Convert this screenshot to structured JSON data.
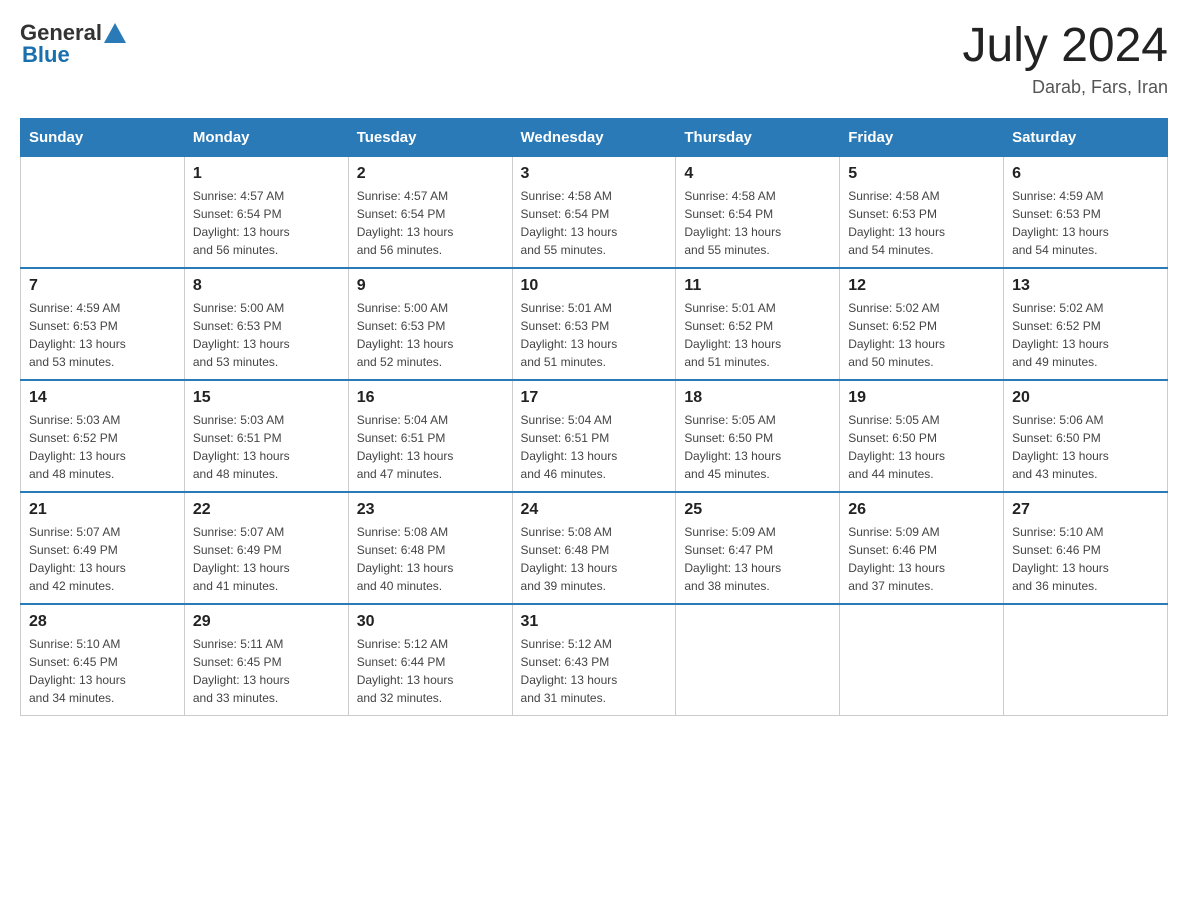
{
  "header": {
    "logo_general": "General",
    "logo_blue": "Blue",
    "month_year": "July 2024",
    "location": "Darab, Fars, Iran"
  },
  "days_of_week": [
    "Sunday",
    "Monday",
    "Tuesday",
    "Wednesday",
    "Thursday",
    "Friday",
    "Saturday"
  ],
  "weeks": [
    [
      {
        "day": "",
        "info": ""
      },
      {
        "day": "1",
        "info": "Sunrise: 4:57 AM\nSunset: 6:54 PM\nDaylight: 13 hours\nand 56 minutes."
      },
      {
        "day": "2",
        "info": "Sunrise: 4:57 AM\nSunset: 6:54 PM\nDaylight: 13 hours\nand 56 minutes."
      },
      {
        "day": "3",
        "info": "Sunrise: 4:58 AM\nSunset: 6:54 PM\nDaylight: 13 hours\nand 55 minutes."
      },
      {
        "day": "4",
        "info": "Sunrise: 4:58 AM\nSunset: 6:54 PM\nDaylight: 13 hours\nand 55 minutes."
      },
      {
        "day": "5",
        "info": "Sunrise: 4:58 AM\nSunset: 6:53 PM\nDaylight: 13 hours\nand 54 minutes."
      },
      {
        "day": "6",
        "info": "Sunrise: 4:59 AM\nSunset: 6:53 PM\nDaylight: 13 hours\nand 54 minutes."
      }
    ],
    [
      {
        "day": "7",
        "info": "Sunrise: 4:59 AM\nSunset: 6:53 PM\nDaylight: 13 hours\nand 53 minutes."
      },
      {
        "day": "8",
        "info": "Sunrise: 5:00 AM\nSunset: 6:53 PM\nDaylight: 13 hours\nand 53 minutes."
      },
      {
        "day": "9",
        "info": "Sunrise: 5:00 AM\nSunset: 6:53 PM\nDaylight: 13 hours\nand 52 minutes."
      },
      {
        "day": "10",
        "info": "Sunrise: 5:01 AM\nSunset: 6:53 PM\nDaylight: 13 hours\nand 51 minutes."
      },
      {
        "day": "11",
        "info": "Sunrise: 5:01 AM\nSunset: 6:52 PM\nDaylight: 13 hours\nand 51 minutes."
      },
      {
        "day": "12",
        "info": "Sunrise: 5:02 AM\nSunset: 6:52 PM\nDaylight: 13 hours\nand 50 minutes."
      },
      {
        "day": "13",
        "info": "Sunrise: 5:02 AM\nSunset: 6:52 PM\nDaylight: 13 hours\nand 49 minutes."
      }
    ],
    [
      {
        "day": "14",
        "info": "Sunrise: 5:03 AM\nSunset: 6:52 PM\nDaylight: 13 hours\nand 48 minutes."
      },
      {
        "day": "15",
        "info": "Sunrise: 5:03 AM\nSunset: 6:51 PM\nDaylight: 13 hours\nand 48 minutes."
      },
      {
        "day": "16",
        "info": "Sunrise: 5:04 AM\nSunset: 6:51 PM\nDaylight: 13 hours\nand 47 minutes."
      },
      {
        "day": "17",
        "info": "Sunrise: 5:04 AM\nSunset: 6:51 PM\nDaylight: 13 hours\nand 46 minutes."
      },
      {
        "day": "18",
        "info": "Sunrise: 5:05 AM\nSunset: 6:50 PM\nDaylight: 13 hours\nand 45 minutes."
      },
      {
        "day": "19",
        "info": "Sunrise: 5:05 AM\nSunset: 6:50 PM\nDaylight: 13 hours\nand 44 minutes."
      },
      {
        "day": "20",
        "info": "Sunrise: 5:06 AM\nSunset: 6:50 PM\nDaylight: 13 hours\nand 43 minutes."
      }
    ],
    [
      {
        "day": "21",
        "info": "Sunrise: 5:07 AM\nSunset: 6:49 PM\nDaylight: 13 hours\nand 42 minutes."
      },
      {
        "day": "22",
        "info": "Sunrise: 5:07 AM\nSunset: 6:49 PM\nDaylight: 13 hours\nand 41 minutes."
      },
      {
        "day": "23",
        "info": "Sunrise: 5:08 AM\nSunset: 6:48 PM\nDaylight: 13 hours\nand 40 minutes."
      },
      {
        "day": "24",
        "info": "Sunrise: 5:08 AM\nSunset: 6:48 PM\nDaylight: 13 hours\nand 39 minutes."
      },
      {
        "day": "25",
        "info": "Sunrise: 5:09 AM\nSunset: 6:47 PM\nDaylight: 13 hours\nand 38 minutes."
      },
      {
        "day": "26",
        "info": "Sunrise: 5:09 AM\nSunset: 6:46 PM\nDaylight: 13 hours\nand 37 minutes."
      },
      {
        "day": "27",
        "info": "Sunrise: 5:10 AM\nSunset: 6:46 PM\nDaylight: 13 hours\nand 36 minutes."
      }
    ],
    [
      {
        "day": "28",
        "info": "Sunrise: 5:10 AM\nSunset: 6:45 PM\nDaylight: 13 hours\nand 34 minutes."
      },
      {
        "day": "29",
        "info": "Sunrise: 5:11 AM\nSunset: 6:45 PM\nDaylight: 13 hours\nand 33 minutes."
      },
      {
        "day": "30",
        "info": "Sunrise: 5:12 AM\nSunset: 6:44 PM\nDaylight: 13 hours\nand 32 minutes."
      },
      {
        "day": "31",
        "info": "Sunrise: 5:12 AM\nSunset: 6:43 PM\nDaylight: 13 hours\nand 31 minutes."
      },
      {
        "day": "",
        "info": ""
      },
      {
        "day": "",
        "info": ""
      },
      {
        "day": "",
        "info": ""
      }
    ]
  ]
}
